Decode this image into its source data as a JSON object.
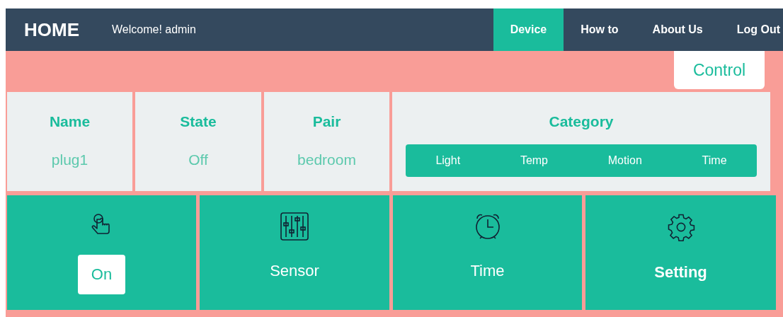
{
  "navbar": {
    "brand": "HOME",
    "welcome": "Welcome! admin",
    "links": [
      {
        "label": "Device",
        "selected": true
      },
      {
        "label": "How to",
        "selected": false
      },
      {
        "label": "About Us",
        "selected": false
      },
      {
        "label": "Log Out",
        "selected": false
      }
    ]
  },
  "control_button": "Control",
  "info": [
    {
      "label": "Name",
      "value": "plug1"
    },
    {
      "label": "State",
      "value": "Off"
    },
    {
      "label": "Pair",
      "value": "bedroom"
    }
  ],
  "category": {
    "label": "Category",
    "options": [
      "Light",
      "Temp",
      "Motion",
      "Time"
    ]
  },
  "tiles": [
    {
      "kind": "button",
      "label": "On"
    },
    {
      "kind": "label",
      "label": "Sensor"
    },
    {
      "kind": "label",
      "label": "Time"
    },
    {
      "kind": "heading",
      "label": "Setting"
    }
  ]
}
